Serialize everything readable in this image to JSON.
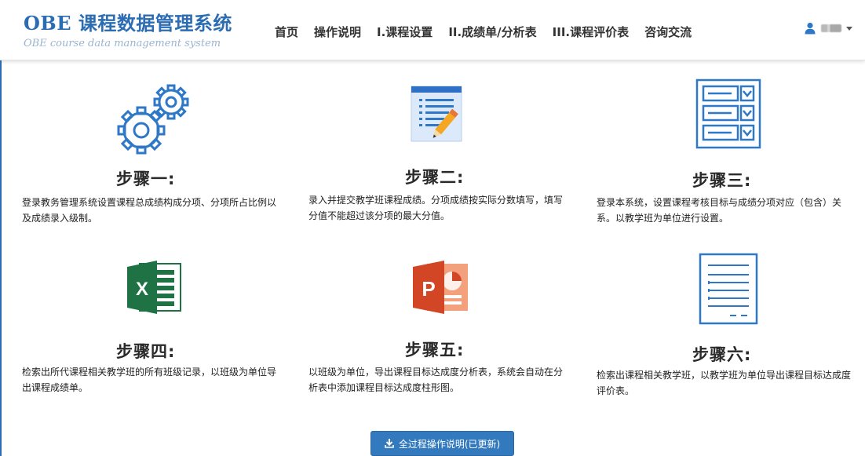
{
  "brand": {
    "title": "OBE 课程数据管理系统",
    "subtitle": "OBE course data management system"
  },
  "nav": {
    "items": [
      {
        "label": "首页"
      },
      {
        "label": "操作说明"
      },
      {
        "label": "I.课程设置"
      },
      {
        "label": "II.成绩单/分析表"
      },
      {
        "label": "III.课程评价表"
      },
      {
        "label": "咨询交流"
      }
    ]
  },
  "user": {
    "icon": "user-icon"
  },
  "steps": [
    {
      "title": "步骤一:",
      "icon": "gears-icon",
      "description": "登录教务管理系统设置课程总成绩构成分项、分项所占比例以及成绩录入级制。"
    },
    {
      "title": "步骤二:",
      "icon": "document-pencil-icon",
      "description": "录入并提交教学班课程成绩。分项成绩按实际分数填写，填写分值不能超过该分项的最大分值。"
    },
    {
      "title": "步骤三:",
      "icon": "form-checklist-icon",
      "description": "登录本系统，设置课程考核目标与成绩分项对应（包含）关系。以教学班为单位进行设置。"
    },
    {
      "title": "步骤四:",
      "icon": "excel-icon",
      "description": "检索出所代课程相关教学班的所有班级记录，以班级为单位导出课程成绩单。"
    },
    {
      "title": "步骤五:",
      "icon": "powerpoint-icon",
      "description": "以班级为单位，导出课程目标达成度分析表，系统会自动在分析表中添加课程目标达成度柱形图。"
    },
    {
      "title": "步骤六:",
      "icon": "report-document-icon",
      "description": "检索出课程相关教学班，以教学班为单位导出课程目标达成度评价表。"
    }
  ],
  "download_button": {
    "label": "全过程操作说明(已更新)",
    "icon": "download-icon"
  },
  "colors": {
    "brand_blue": "#2b6cb3",
    "button_blue": "#3279be",
    "icon_blue": "#2f78c8",
    "excel_green": "#1f7244",
    "ppt_orange": "#d24625"
  }
}
